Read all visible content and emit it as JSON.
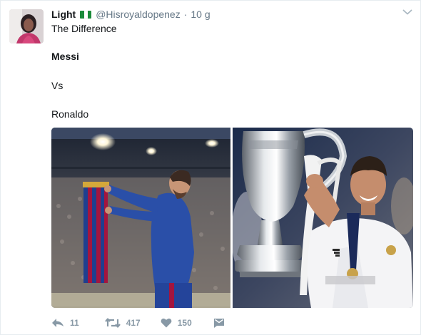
{
  "tweet": {
    "display_name": "Light",
    "handle": "@Hisroyaldopenez",
    "separator": "·",
    "time": "10 g",
    "lines": {
      "line1": "The Difference",
      "line2": "Messi",
      "line3": "Vs",
      "line4": "Ronaldo"
    },
    "media": {
      "left_photo": "messi-photo",
      "right_photo": "ronaldo-photo"
    },
    "actions": {
      "reply_count": "11",
      "retweet_count": "417",
      "like_count": "150"
    }
  },
  "colors": {
    "muted": "#8899a6",
    "text": "#14171a",
    "handle": "#657786",
    "flag_green": "#1a8a3a"
  }
}
